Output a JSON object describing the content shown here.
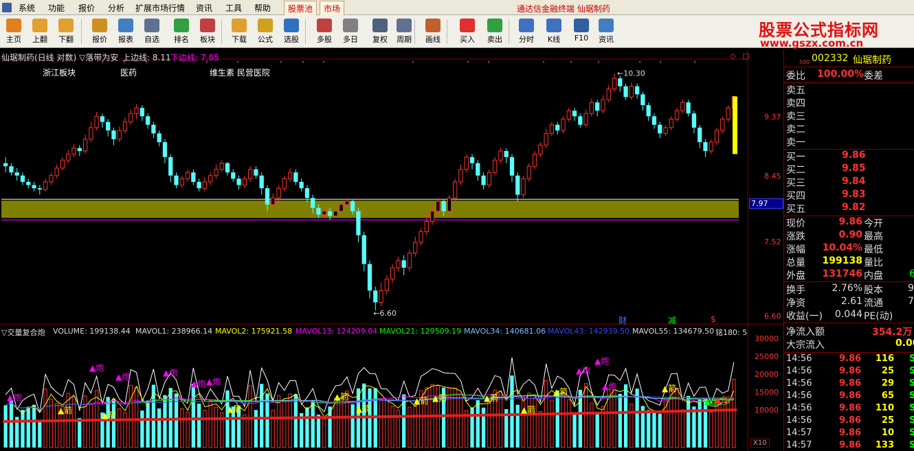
{
  "menu": {
    "items": [
      "系统",
      "功能",
      "报价",
      "分析",
      "扩展市场行情",
      "资讯",
      "工具",
      "帮助"
    ],
    "tabs": [
      "股票池",
      "市场"
    ],
    "ad_text": "通达信金融终端  仙琚制药"
  },
  "toolbar": {
    "buttons": [
      {
        "label": "主页",
        "icon": "home-icon",
        "color": "#e08020"
      },
      {
        "label": "上翻",
        "icon": "arrow-up-icon",
        "color": "#e0a030"
      },
      {
        "label": "下翻",
        "icon": "arrow-down-icon",
        "color": "#e0a030"
      },
      {
        "label": "报价",
        "icon": "yen-icon",
        "color": "#d09020"
      },
      {
        "label": "报表",
        "icon": "report-icon",
        "color": "#4080c0"
      },
      {
        "label": "自选",
        "icon": "f6-icon",
        "color": "#607090"
      },
      {
        "label": "排名",
        "icon": "ranking-icon",
        "color": "#30a040"
      },
      {
        "label": "板块",
        "icon": "blocks-icon",
        "color": "#c04040"
      },
      {
        "label": "下载",
        "icon": "download-icon",
        "color": "#e0a030"
      },
      {
        "label": "公式",
        "icon": "formula-icon",
        "color": "#d0a020"
      },
      {
        "label": "选股",
        "icon": "stock-pick-icon",
        "color": "#3070c0"
      },
      {
        "label": "多股",
        "icon": "multi-stock-icon",
        "color": "#c04040"
      },
      {
        "label": "多日",
        "icon": "clock-icon",
        "color": "#808080"
      },
      {
        "label": "复权",
        "icon": "restore-icon",
        "color": "#506080"
      },
      {
        "label": "周期",
        "icon": "f8-icon",
        "color": "#607090"
      },
      {
        "label": "画线",
        "icon": "draw-line-icon",
        "color": "#c06030"
      },
      {
        "label": "买入",
        "icon": "buy-icon",
        "color": "#e03030"
      },
      {
        "label": "卖出",
        "icon": "sell-icon",
        "color": "#30a040"
      },
      {
        "label": "分时",
        "icon": "intraday-icon",
        "color": "#4070c0"
      },
      {
        "label": "K线",
        "icon": "kline-icon",
        "color": "#4070c0"
      },
      {
        "label": "F10",
        "icon": "f10-icon",
        "color": "#3060a0"
      },
      {
        "label": "资讯",
        "icon": "news-icon",
        "color": "#4080c0"
      }
    ],
    "brand_name": "股票公式指标网",
    "brand_url": "www.gszx.com.cn"
  },
  "main_chart": {
    "title": "仙琚制药(日线 对数)",
    "indicator": "▽落带为安",
    "upper_label": "上边线: 8.11",
    "lower_label": "下边线: 7.85",
    "tags": [
      "浙江板块",
      "医药",
      "维生素 民营医院"
    ],
    "high_annotation": "10.30",
    "low_annotation": "6.60",
    "price_axis": [
      "9.37",
      "8.45",
      "7.52",
      "6.60"
    ],
    "current_price_tag": "7.97",
    "markers": [
      "财",
      "减",
      "$"
    ],
    "colors": {
      "up": "#ff3232",
      "down": "#54ffff",
      "band": "#808000",
      "purple": "#ff00ff"
    }
  },
  "chart_data": {
    "type": "candlestick",
    "yscale": "log",
    "ylim": [
      6.45,
      10.55
    ],
    "band": [
      7.85,
      8.11
    ],
    "candles": [
      [
        8.7,
        8.65,
        8.8,
        8.55
      ],
      [
        8.65,
        8.55,
        8.7,
        8.5
      ],
      [
        8.55,
        8.5,
        8.62,
        8.42
      ],
      [
        8.5,
        8.4,
        8.55,
        8.35
      ],
      [
        8.4,
        8.35,
        8.45,
        8.3
      ],
      [
        8.35,
        8.3,
        8.4,
        8.25
      ],
      [
        8.3,
        8.28,
        8.35,
        8.2
      ],
      [
        8.28,
        8.4,
        8.45,
        8.25
      ],
      [
        8.4,
        8.5,
        8.55,
        8.35
      ],
      [
        8.5,
        8.62,
        8.68,
        8.45
      ],
      [
        8.62,
        8.75,
        8.8,
        8.58
      ],
      [
        8.75,
        8.85,
        8.92,
        8.7
      ],
      [
        8.85,
        8.95,
        9.02,
        8.8
      ],
      [
        8.95,
        8.9,
        9.0,
        8.82
      ],
      [
        8.9,
        9.1,
        9.18,
        8.85
      ],
      [
        9.1,
        9.3,
        9.4,
        9.05
      ],
      [
        9.3,
        9.5,
        9.58,
        9.25
      ],
      [
        9.5,
        9.4,
        9.55,
        9.3
      ],
      [
        9.4,
        9.25,
        9.45,
        9.15
      ],
      [
        9.25,
        9.1,
        9.3,
        9.0
      ],
      [
        9.1,
        9.25,
        9.32,
        9.05
      ],
      [
        9.25,
        9.4,
        9.48,
        9.2
      ],
      [
        9.4,
        9.55,
        9.62,
        9.35
      ],
      [
        9.55,
        9.65,
        9.72,
        9.45
      ],
      [
        9.65,
        9.5,
        9.7,
        9.42
      ],
      [
        9.5,
        9.35,
        9.55,
        9.28
      ],
      [
        9.35,
        9.2,
        9.4,
        9.12
      ],
      [
        9.2,
        9.05,
        9.25,
        8.98
      ],
      [
        9.05,
        8.8,
        9.1,
        8.7
      ],
      [
        8.8,
        8.5,
        8.85,
        8.4
      ],
      [
        8.5,
        8.35,
        8.55,
        8.3
      ],
      [
        8.35,
        8.45,
        8.5,
        8.3
      ],
      [
        8.45,
        8.55,
        8.6,
        8.4
      ],
      [
        8.55,
        8.4,
        8.6,
        8.35
      ],
      [
        8.4,
        8.3,
        8.45,
        8.25
      ],
      [
        8.3,
        8.4,
        8.48,
        8.25
      ],
      [
        8.4,
        8.5,
        8.55,
        8.35
      ],
      [
        8.5,
        8.6,
        8.68,
        8.45
      ],
      [
        8.6,
        8.7,
        8.75,
        8.55
      ],
      [
        8.7,
        8.55,
        8.72,
        8.5
      ],
      [
        8.55,
        8.45,
        8.6,
        8.4
      ],
      [
        8.45,
        8.35,
        8.5,
        8.28
      ],
      [
        8.35,
        8.45,
        8.5,
        8.3
      ],
      [
        8.45,
        8.6,
        8.65,
        8.4
      ],
      [
        8.6,
        8.5,
        8.65,
        8.45
      ],
      [
        8.5,
        8.3,
        8.55,
        8.2
      ],
      [
        8.3,
        8.05,
        8.35,
        7.95
      ],
      [
        8.05,
        8.15,
        8.22,
        8.0
      ],
      [
        8.15,
        8.3,
        8.35,
        8.1
      ],
      [
        8.3,
        8.45,
        8.5,
        8.25
      ],
      [
        8.45,
        8.55,
        8.62,
        8.4
      ],
      [
        8.55,
        8.4,
        8.6,
        8.35
      ],
      [
        8.4,
        8.3,
        8.45,
        8.25
      ],
      [
        8.3,
        8.15,
        8.35,
        8.08
      ],
      [
        8.15,
        8.0,
        8.2,
        7.92
      ],
      [
        8.0,
        7.9,
        8.05,
        7.85
      ],
      [
        7.9,
        7.95,
        8.0,
        7.85
      ],
      [
        7.95,
        7.88,
        8.0,
        7.82
      ],
      [
        7.88,
        7.95,
        8.02,
        7.85
      ],
      [
        7.95,
        8.05,
        8.1,
        7.9
      ],
      [
        8.05,
        8.1,
        8.15,
        8.0
      ],
      [
        8.1,
        7.95,
        8.12,
        7.9
      ],
      [
        7.95,
        7.6,
        8.0,
        7.5
      ],
      [
        7.6,
        7.2,
        7.65,
        7.1
      ],
      [
        7.2,
        6.85,
        7.25,
        6.75
      ],
      [
        6.85,
        6.7,
        6.9,
        6.6
      ],
      [
        6.7,
        6.85,
        6.95,
        6.65
      ],
      [
        6.85,
        7.0,
        7.05,
        6.8
      ],
      [
        7.0,
        7.15,
        7.2,
        6.95
      ],
      [
        7.15,
        7.25,
        7.3,
        7.1
      ],
      [
        7.25,
        7.15,
        7.32,
        7.05
      ],
      [
        7.15,
        7.35,
        7.4,
        7.1
      ],
      [
        7.35,
        7.5,
        7.58,
        7.3
      ],
      [
        7.5,
        7.65,
        7.7,
        7.45
      ],
      [
        7.65,
        7.8,
        7.88,
        7.6
      ],
      [
        7.8,
        7.95,
        8.02,
        7.75
      ],
      [
        7.95,
        8.1,
        8.15,
        7.9
      ],
      [
        8.1,
        7.95,
        8.12,
        7.88
      ],
      [
        7.95,
        8.15,
        8.2,
        7.9
      ],
      [
        8.15,
        8.4,
        8.45,
        8.1
      ],
      [
        8.4,
        8.6,
        8.68,
        8.35
      ],
      [
        8.6,
        8.8,
        8.85,
        8.55
      ],
      [
        8.8,
        8.7,
        8.85,
        8.6
      ],
      [
        8.7,
        8.5,
        8.75,
        8.42
      ],
      [
        8.5,
        8.35,
        8.55,
        8.28
      ],
      [
        8.35,
        8.55,
        8.6,
        8.3
      ],
      [
        8.55,
        8.75,
        8.8,
        8.5
      ],
      [
        8.75,
        8.9,
        8.95,
        8.7
      ],
      [
        8.9,
        8.8,
        8.95,
        8.7
      ],
      [
        8.8,
        8.5,
        8.85,
        8.4
      ],
      [
        8.5,
        8.2,
        8.55,
        8.1
      ],
      [
        8.2,
        8.45,
        8.5,
        8.15
      ],
      [
        8.45,
        8.65,
        8.7,
        8.4
      ],
      [
        8.65,
        8.85,
        8.9,
        8.6
      ],
      [
        8.85,
        9.0,
        9.05,
        8.8
      ],
      [
        9.0,
        9.2,
        9.28,
        8.95
      ],
      [
        9.2,
        9.35,
        9.4,
        9.15
      ],
      [
        9.35,
        9.25,
        9.4,
        9.18
      ],
      [
        9.25,
        9.45,
        9.5,
        9.2
      ],
      [
        9.45,
        9.6,
        9.65,
        9.4
      ],
      [
        9.6,
        9.5,
        9.65,
        9.42
      ],
      [
        9.5,
        9.35,
        9.55,
        9.3
      ],
      [
        9.35,
        9.55,
        9.62,
        9.3
      ],
      [
        9.55,
        9.75,
        9.82,
        9.5
      ],
      [
        9.75,
        9.6,
        9.8,
        9.5
      ],
      [
        9.6,
        9.8,
        9.88,
        9.55
      ],
      [
        9.8,
        10.0,
        10.08,
        9.75
      ],
      [
        10.0,
        10.2,
        10.3,
        9.95
      ],
      [
        10.2,
        10.05,
        10.25,
        9.95
      ],
      [
        10.05,
        9.85,
        10.1,
        9.8
      ],
      [
        9.85,
        10.05,
        10.12,
        9.8
      ],
      [
        10.05,
        9.9,
        10.1,
        9.82
      ],
      [
        9.9,
        9.7,
        9.95,
        9.6
      ],
      [
        9.7,
        9.5,
        9.75,
        9.42
      ],
      [
        9.5,
        9.35,
        9.55,
        9.28
      ],
      [
        9.35,
        9.2,
        9.4,
        9.12
      ],
      [
        9.2,
        9.3,
        9.35,
        9.15
      ],
      [
        9.3,
        9.45,
        9.5,
        9.25
      ],
      [
        9.45,
        9.6,
        9.65,
        9.4
      ],
      [
        9.6,
        9.75,
        9.8,
        9.55
      ],
      [
        9.75,
        9.55,
        9.8,
        9.5
      ],
      [
        9.55,
        9.3,
        9.6,
        9.2
      ],
      [
        9.3,
        9.05,
        9.35,
        8.95
      ],
      [
        9.05,
        8.9,
        9.1,
        8.8
      ],
      [
        8.9,
        9.05,
        9.1,
        8.85
      ],
      [
        9.05,
        9.25,
        9.3,
        9.0
      ],
      [
        9.25,
        9.45,
        9.5,
        9.2
      ],
      [
        9.45,
        9.65,
        9.7,
        9.4
      ],
      [
        9.65,
        9.86,
        9.86,
        9.6
      ]
    ],
    "volume": {
      "ylim": [
        0,
        32000
      ],
      "axis": [
        "30000",
        "25000",
        "20000",
        "15000",
        "10000"
      ],
      "multiplier": "X10",
      "legend": [
        {
          "text": "▽交量复合炮",
          "color": "#dddddd"
        },
        {
          "text": "VOLUME: 199138.44",
          "color": "#dddddd"
        },
        {
          "text": "MAVOL1: 238966.14",
          "color": "#dddddd"
        },
        {
          "text": "MAVOL2: 175921.58",
          "color": "#ffff00"
        },
        {
          "text": "MAVOL13: 124209.04",
          "color": "#ff00ff"
        },
        {
          "text": "MAVOL21: 129509.19",
          "color": "#00ff00"
        },
        {
          "text": "MAVOL34: 140681.06",
          "color": "#80c0ff"
        },
        {
          "text": "MAVOL43: 142939.50",
          "color": "#4040ff"
        },
        {
          "text": "MAVOL55: 134679.50",
          "color": "#dddddd"
        },
        {
          "text": "铭180: 5",
          "color": "#dddddd"
        }
      ],
      "signals": [
        {
          "text": "▲炮",
          "color": "#ff00ff"
        },
        {
          "text": "▲炮",
          "color": "#ff00ff"
        },
        {
          "text": "▲炮",
          "color": "#ff00ff"
        },
        {
          "text": "▲炮",
          "color": "#ff00ff"
        },
        {
          "text": "▲炮",
          "color": "#ff00ff"
        },
        {
          "text": "▲炮",
          "color": "#ff00ff"
        },
        {
          "text": "▲炮",
          "color": "#ff00ff"
        },
        {
          "text": "▲炮",
          "color": "#ff00ff"
        },
        {
          "text": "▲炮",
          "color": "#ff00ff"
        },
        {
          "text": "▲箭",
          "color": "#ffff00"
        },
        {
          "text": "▲箭",
          "color": "#ffff00"
        },
        {
          "text": "▲箭",
          "color": "#ffff00"
        },
        {
          "text": "▲箭",
          "color": "#ffff00"
        },
        {
          "text": "▲箭",
          "color": "#ffff00"
        },
        {
          "text": "▲箭",
          "color": "#ffff00"
        },
        {
          "text": "▲箭",
          "color": "#ffff00"
        },
        {
          "text": "▲箭",
          "color": "#ffff00"
        },
        {
          "text": "▲箭",
          "color": "#ffff00"
        },
        {
          "text": "▲箭",
          "color": "#ffff00"
        },
        {
          "text": "▲箭",
          "color": "#ffff00"
        },
        {
          "text": "▲出刀",
          "color": "#00ff00"
        },
        {
          "text": "▲剑",
          "color": "#ff3232"
        }
      ]
    }
  },
  "quote": {
    "code": "002332",
    "name": "仙琚制药",
    "sub_label": "500",
    "weibi": {
      "label": "委比",
      "value": "100.00%",
      "label2": "委差"
    },
    "sells": [
      {
        "label": "卖五"
      },
      {
        "label": "卖四"
      },
      {
        "label": "卖三"
      },
      {
        "label": "卖二"
      },
      {
        "label": "卖一"
      }
    ],
    "buys": [
      {
        "label": "买一",
        "price": "9.86"
      },
      {
        "label": "买二",
        "price": "9.85"
      },
      {
        "label": "买三",
        "price": "9.84"
      },
      {
        "label": "买四",
        "price": "9.83"
      },
      {
        "label": "买五",
        "price": "9.82"
      }
    ],
    "stats": [
      {
        "l1": "现价",
        "v1": "9.86",
        "l2": "今开",
        "v2": "",
        "c": "#ff3232"
      },
      {
        "l1": "涨跌",
        "v1": "0.90",
        "l2": "最高",
        "v2": "",
        "c": "#ff3232"
      },
      {
        "l1": "涨幅",
        "v1": "10.04%",
        "l2": "最低",
        "v2": "",
        "c": "#ff3232"
      },
      {
        "l1": "总量",
        "v1": "199138",
        "l2": "量比",
        "v2": "",
        "c": "#ffff00"
      },
      {
        "l1": "外盘",
        "v1": "131746",
        "l2": "内盘",
        "v2": "6",
        "c": "#ff3232"
      }
    ],
    "finance": [
      {
        "l1": "换手",
        "v1": "2.76%",
        "l2": "股本",
        "v2": "9."
      },
      {
        "l1": "净资",
        "v1": "2.61",
        "l2": "流通",
        "v2": "7."
      },
      {
        "l1": "收益(一)",
        "v1": "0.044",
        "l2": "PE(动)",
        "v2": ""
      }
    ],
    "net_inflow": {
      "label": "净流入额",
      "value": "354.2万"
    },
    "block_inflow": {
      "label": "大宗流入",
      "value": "0.00"
    },
    "ticks": [
      {
        "time": "14:56",
        "price": "9.86",
        "vol": "116",
        "side": "S"
      },
      {
        "time": "14:56",
        "price": "9.86",
        "vol": "25",
        "side": "S"
      },
      {
        "time": "14:56",
        "price": "9.86",
        "vol": "29",
        "side": "S"
      },
      {
        "time": "14:56",
        "price": "9.86",
        "vol": "65",
        "side": "S"
      },
      {
        "time": "14:56",
        "price": "9.86",
        "vol": "110",
        "side": "S"
      },
      {
        "time": "14:56",
        "price": "9.86",
        "vol": "25",
        "side": "S"
      },
      {
        "time": "14:57",
        "price": "9.86",
        "vol": "10",
        "side": "S"
      },
      {
        "time": "14:57",
        "price": "9.86",
        "vol": "133",
        "side": "S"
      }
    ]
  }
}
